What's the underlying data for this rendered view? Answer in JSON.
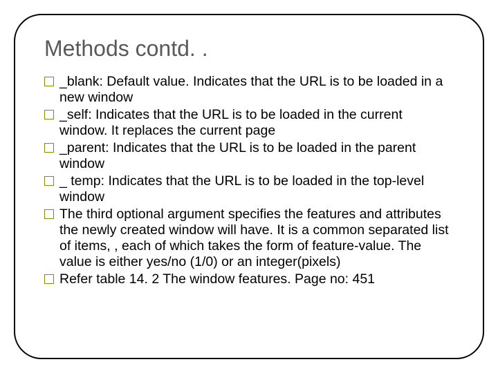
{
  "title": "Methods contd. .",
  "bullets": [
    "_blank: Default value. Indicates that the URL is to be loaded in a new window",
    "_self: Indicates that the URL is to be loaded in the current window. It replaces the current page",
    "_parent: Indicates that the URL is to be loaded in the parent window",
    "_ temp: Indicates that the URL is to be loaded in the top-level window",
    "The third optional argument specifies the features and attributes the newly created window will have. It is a common separated list of items, , each of which takes the form of feature-value. The value is either yes/no (1/0)  or an integer(pixels)",
    "Refer table 14. 2 The window features. Page no: 451"
  ]
}
